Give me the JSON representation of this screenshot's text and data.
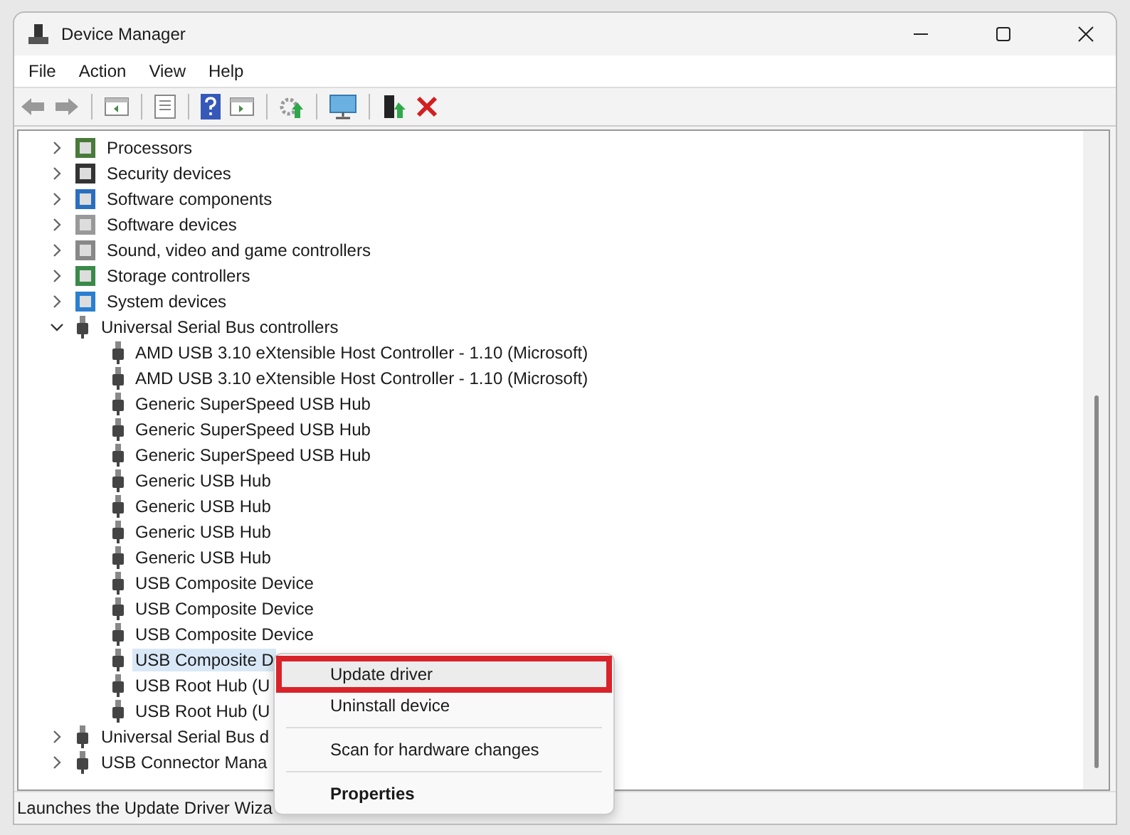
{
  "window": {
    "title": "Device Manager"
  },
  "menu_bar": [
    "File",
    "Action",
    "View",
    "Help"
  ],
  "tree": [
    {
      "label": "Processors",
      "expanded": false,
      "selected": false
    },
    {
      "label": "Security devices",
      "expanded": false,
      "selected": false
    },
    {
      "label": "Software components",
      "expanded": false,
      "selected": false
    },
    {
      "label": "Software devices",
      "expanded": false,
      "selected": false
    },
    {
      "label": "Sound, video and game controllers",
      "expanded": false,
      "selected": false
    },
    {
      "label": "Storage controllers",
      "expanded": false,
      "selected": false
    },
    {
      "label": "System devices",
      "expanded": false,
      "selected": false
    },
    {
      "label": "Universal Serial Bus controllers",
      "expanded": true,
      "selected": false,
      "children": [
        {
          "label": "AMD USB 3.10 eXtensible Host Controller - 1.10 (Microsoft)",
          "selected": false
        },
        {
          "label": "AMD USB 3.10 eXtensible Host Controller - 1.10 (Microsoft)",
          "selected": false
        },
        {
          "label": "Generic SuperSpeed USB Hub",
          "selected": false
        },
        {
          "label": "Generic SuperSpeed USB Hub",
          "selected": false
        },
        {
          "label": "Generic SuperSpeed USB Hub",
          "selected": false
        },
        {
          "label": "Generic USB Hub",
          "selected": false
        },
        {
          "label": "Generic USB Hub",
          "selected": false
        },
        {
          "label": "Generic USB Hub",
          "selected": false
        },
        {
          "label": "Generic USB Hub",
          "selected": false
        },
        {
          "label": "USB Composite Device",
          "selected": false
        },
        {
          "label": "USB Composite Device",
          "selected": false
        },
        {
          "label": "USB Composite Device",
          "selected": false
        },
        {
          "label": "USB Composite D",
          "selected": true
        },
        {
          "label": "USB Root Hub (U",
          "selected": false
        },
        {
          "label": "USB Root Hub (U",
          "selected": false
        }
      ]
    },
    {
      "label": "Universal Serial Bus d",
      "expanded": false,
      "selected": false
    },
    {
      "label": "USB Connector Mana",
      "expanded": false,
      "selected": false
    }
  ],
  "context_menu": [
    {
      "kind": "item",
      "label": "Update driver",
      "highlighted": true,
      "bold": false
    },
    {
      "kind": "item",
      "label": "Uninstall device",
      "highlighted": false,
      "bold": false
    },
    {
      "kind": "separator"
    },
    {
      "kind": "item",
      "label": "Scan for hardware changes",
      "highlighted": false,
      "bold": false
    },
    {
      "kind": "separator"
    },
    {
      "kind": "item",
      "label": "Properties",
      "highlighted": false,
      "bold": true
    }
  ],
  "status_bar": "Launches the Update Driver Wiza"
}
